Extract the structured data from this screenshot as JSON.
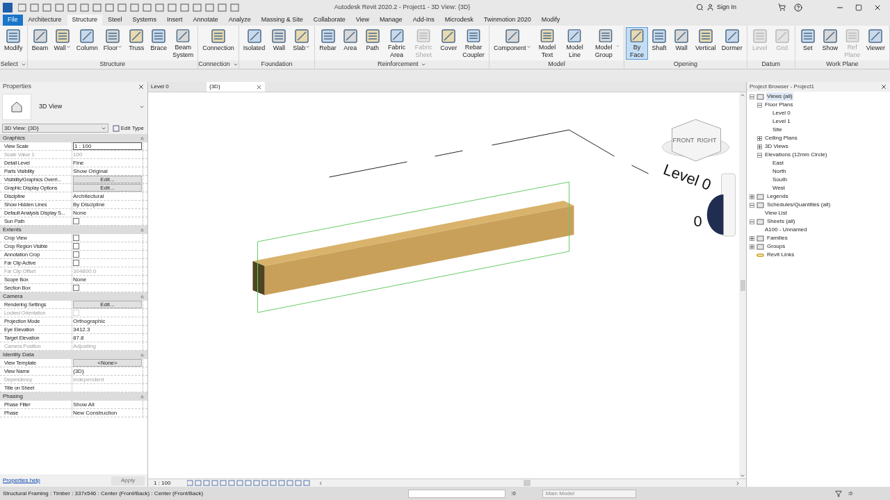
{
  "window": {
    "title": "Autodesk Revit 2020.2 - Project1 - 3D View: {3D}",
    "sign_in": "Sign In"
  },
  "menu_tabs": [
    {
      "label": "File",
      "kind": "file",
      "selected": false
    },
    {
      "label": "Architecture",
      "kind": "tab",
      "selected": false
    },
    {
      "label": "Structure",
      "kind": "tab",
      "selected": true
    },
    {
      "label": "Steel",
      "kind": "tab",
      "selected": false
    },
    {
      "label": "Systems",
      "kind": "tab",
      "selected": false
    },
    {
      "label": "Insert",
      "kind": "tab",
      "selected": false
    },
    {
      "label": "Annotate",
      "kind": "tab",
      "selected": false
    },
    {
      "label": "Analyze",
      "kind": "tab",
      "selected": false
    },
    {
      "label": "Massing & Site",
      "kind": "tab",
      "selected": false
    },
    {
      "label": "Collaborate",
      "kind": "tab",
      "selected": false
    },
    {
      "label": "View",
      "kind": "tab",
      "selected": false
    },
    {
      "label": "Manage",
      "kind": "tab",
      "selected": false
    },
    {
      "label": "Add-Ins",
      "kind": "tab",
      "selected": false
    },
    {
      "label": "Microdesk",
      "kind": "tab",
      "selected": false
    },
    {
      "label": "Twinmotion 2020",
      "kind": "tab",
      "selected": false
    },
    {
      "label": "Modify",
      "kind": "tab",
      "selected": false
    }
  ],
  "ribbon_panels": [
    {
      "title": "Select",
      "menu": true,
      "tools": [
        {
          "label": "Modify",
          "disabled": false,
          "selected": false,
          "dropdown": false
        }
      ]
    },
    {
      "title": "Structure",
      "menu": false,
      "tools": [
        {
          "label": "Beam",
          "disabled": false,
          "selected": false,
          "dropdown": false
        },
        {
          "label": "Wall",
          "disabled": false,
          "selected": false,
          "dropdown": true
        },
        {
          "label": "Column",
          "disabled": false,
          "selected": false,
          "dropdown": false
        },
        {
          "label": "Floor",
          "disabled": false,
          "selected": false,
          "dropdown": true
        },
        {
          "label": "Truss",
          "disabled": false,
          "selected": false,
          "dropdown": false
        },
        {
          "label": "Brace",
          "disabled": false,
          "selected": false,
          "dropdown": false
        },
        {
          "label": "Beam System",
          "disabled": false,
          "selected": false,
          "dropdown": false
        }
      ]
    },
    {
      "title": "Connection",
      "menu": true,
      "tools": [
        {
          "label": "Connection",
          "disabled": false,
          "selected": false,
          "dropdown": false
        }
      ]
    },
    {
      "title": "Foundation",
      "menu": false,
      "tools": [
        {
          "label": "Isolated",
          "disabled": false,
          "selected": false,
          "dropdown": false
        },
        {
          "label": "Wall",
          "disabled": false,
          "selected": false,
          "dropdown": false
        },
        {
          "label": "Slab",
          "disabled": false,
          "selected": false,
          "dropdown": true
        }
      ]
    },
    {
      "title": "Reinforcement",
      "menu": true,
      "tools": [
        {
          "label": "Rebar",
          "disabled": false,
          "selected": false,
          "dropdown": false
        },
        {
          "label": "Area",
          "disabled": false,
          "selected": false,
          "dropdown": false
        },
        {
          "label": "Path",
          "disabled": false,
          "selected": false,
          "dropdown": false
        },
        {
          "label": "Fabric Area",
          "disabled": false,
          "selected": false,
          "dropdown": false
        },
        {
          "label": "Fabric Sheet",
          "disabled": true,
          "selected": false,
          "dropdown": false
        },
        {
          "label": "Cover",
          "disabled": false,
          "selected": false,
          "dropdown": false
        },
        {
          "label": "Rebar Coupler",
          "disabled": false,
          "selected": false,
          "dropdown": false
        }
      ]
    },
    {
      "title": "Model",
      "menu": false,
      "tools": [
        {
          "label": "Component",
          "disabled": false,
          "selected": false,
          "dropdown": true
        },
        {
          "label": "Model Text",
          "disabled": false,
          "selected": false,
          "dropdown": false
        },
        {
          "label": "Model Line",
          "disabled": false,
          "selected": false,
          "dropdown": false
        },
        {
          "label": "Model Group",
          "disabled": false,
          "selected": false,
          "dropdown": true
        }
      ]
    },
    {
      "title": "Opening",
      "menu": false,
      "tools": [
        {
          "label": "By Face",
          "disabled": false,
          "selected": true,
          "dropdown": false
        },
        {
          "label": "Shaft",
          "disabled": false,
          "selected": false,
          "dropdown": false
        },
        {
          "label": "Wall",
          "disabled": false,
          "selected": false,
          "dropdown": false
        },
        {
          "label": "Vertical",
          "disabled": false,
          "selected": false,
          "dropdown": false
        },
        {
          "label": "Dormer",
          "disabled": false,
          "selected": false,
          "dropdown": false
        }
      ]
    },
    {
      "title": "Datum",
      "menu": false,
      "tools": [
        {
          "label": "Level",
          "disabled": true,
          "selected": false,
          "dropdown": false
        },
        {
          "label": "Grid",
          "disabled": true,
          "selected": false,
          "dropdown": false
        }
      ]
    },
    {
      "title": "Work Plane",
      "menu": false,
      "tools": [
        {
          "label": "Set",
          "disabled": false,
          "selected": false,
          "dropdown": false
        },
        {
          "label": "Show",
          "disabled": false,
          "selected": false,
          "dropdown": false
        },
        {
          "label": "Ref Plane",
          "disabled": true,
          "selected": false,
          "dropdown": false
        },
        {
          "label": "Viewer",
          "disabled": false,
          "selected": false,
          "dropdown": false
        }
      ]
    }
  ],
  "properties": {
    "title": "Properties",
    "type_name": "3D View",
    "instance": "3D View: {3D}",
    "edit_type": "Edit Type",
    "sections": [
      {
        "title": "Graphics",
        "expanded": true,
        "rows": [
          {
            "label": "View Scale",
            "value": "1 : 100",
            "kind": "input",
            "disabled": false
          },
          {
            "label": "Scale Value    1:",
            "value": "100",
            "kind": "text",
            "disabled": true
          },
          {
            "label": "Detail Level",
            "value": "Fine",
            "kind": "text",
            "disabled": false
          },
          {
            "label": "Parts Visibility",
            "value": "Show Original",
            "kind": "text",
            "disabled": false
          },
          {
            "label": "Visibility/Graphics Overri...",
            "value": "Edit...",
            "kind": "button",
            "disabled": false
          },
          {
            "label": "Graphic Display Options",
            "value": "Edit...",
            "kind": "button",
            "disabled": false
          },
          {
            "label": "Discipline",
            "value": "Architectural",
            "kind": "text",
            "disabled": false
          },
          {
            "label": "Show Hidden Lines",
            "value": "By Discipline",
            "kind": "text",
            "disabled": false
          },
          {
            "label": "Default Analysis Display S...",
            "value": "None",
            "kind": "text",
            "disabled": false
          },
          {
            "label": "Sun Path",
            "checked": false,
            "kind": "checkbox",
            "disabled": false
          }
        ]
      },
      {
        "title": "Extents",
        "expanded": true,
        "rows": [
          {
            "label": "Crop View",
            "checked": false,
            "kind": "checkbox",
            "disabled": false
          },
          {
            "label": "Crop Region Visible",
            "checked": false,
            "kind": "checkbox",
            "disabled": false
          },
          {
            "label": "Annotation Crop",
            "checked": false,
            "kind": "checkbox",
            "disabled": false
          },
          {
            "label": "Far Clip Active",
            "checked": false,
            "kind": "checkbox",
            "disabled": false
          },
          {
            "label": "Far Clip Offset",
            "value": "304800.0",
            "kind": "text",
            "disabled": true
          },
          {
            "label": "Scope Box",
            "value": "None",
            "kind": "text",
            "disabled": false
          },
          {
            "label": "Section Box",
            "checked": false,
            "kind": "checkbox",
            "disabled": false
          }
        ]
      },
      {
        "title": "Camera",
        "expanded": true,
        "rows": [
          {
            "label": "Rendering Settings",
            "value": "Edit...",
            "kind": "button",
            "disabled": false
          },
          {
            "label": "Locked Orientation",
            "checked": false,
            "kind": "checkbox",
            "disabled": true
          },
          {
            "label": "Projection Mode",
            "value": "Orthographic",
            "kind": "text",
            "disabled": false
          },
          {
            "label": "Eye Elevation",
            "value": "3412.3",
            "kind": "text",
            "disabled": false
          },
          {
            "label": "Target Elevation",
            "value": "87.8",
            "kind": "text",
            "disabled": false
          },
          {
            "label": "Camera Position",
            "value": "Adjusting",
            "kind": "text",
            "disabled": true
          }
        ]
      },
      {
        "title": "Identity Data",
        "expanded": true,
        "rows": [
          {
            "label": "View Template",
            "value": "<None>",
            "kind": "button",
            "disabled": false
          },
          {
            "label": "View Name",
            "value": "{3D}",
            "kind": "text",
            "disabled": false
          },
          {
            "label": "Dependency",
            "value": "Independent",
            "kind": "text",
            "disabled": true
          },
          {
            "label": "Title on Sheet",
            "value": "",
            "kind": "text",
            "disabled": false
          }
        ]
      },
      {
        "title": "Phasing",
        "expanded": true,
        "rows": [
          {
            "label": "Phase Filter",
            "value": "Show All",
            "kind": "text",
            "disabled": false
          },
          {
            "label": "Phase",
            "value": "New Construction",
            "kind": "text",
            "disabled": false
          }
        ]
      }
    ],
    "help_link": "Properties help",
    "apply": "Apply",
    "apply_disabled": true
  },
  "view_tabs": [
    {
      "label": "Level 0",
      "selected": false
    },
    {
      "label": "{3D}",
      "selected": true
    }
  ],
  "viewport": {
    "level_label": "Level 0",
    "level_tag": "0",
    "viewcube": [
      "FRONT",
      "RIGHT"
    ],
    "scale": "1 : 100"
  },
  "project_browser": {
    "title": "Project Browser - Project1",
    "tree": [
      {
        "label": "Views (all)",
        "expanded": true,
        "selected": true,
        "children": [
          {
            "label": "Floor Plans",
            "expanded": true,
            "children": [
              {
                "label": "Level 0"
              },
              {
                "label": "Level 1"
              },
              {
                "label": "Site"
              }
            ]
          },
          {
            "label": "Ceiling Plans",
            "expanded": false
          },
          {
            "label": "3D Views",
            "expanded": false
          },
          {
            "label": "Elevations (12mm Circle)",
            "expanded": true,
            "children": [
              {
                "label": "East"
              },
              {
                "label": "North"
              },
              {
                "label": "South"
              },
              {
                "label": "West"
              }
            ]
          }
        ]
      },
      {
        "label": "Legends",
        "expanded": false,
        "selected": false
      },
      {
        "label": "Schedules/Quantities (all)",
        "expanded": true,
        "selected": false,
        "children": [
          {
            "label": "View List"
          }
        ]
      },
      {
        "label": "Sheets (all)",
        "expanded": true,
        "selected": false,
        "children": [
          {
            "label": "A100 - Unnamed"
          }
        ]
      },
      {
        "label": "Families",
        "expanded": false,
        "selected": false
      },
      {
        "label": "Groups",
        "expanded": false,
        "selected": false
      },
      {
        "label": "Revit Links",
        "selected": false
      }
    ]
  },
  "status_bar": {
    "message": "Structural Framing : Timber : 337x546 : Center (Front/Back) : Center (Front/Back)",
    "worksets_count": ":0",
    "model": "Main Model",
    "filter_count": ":0"
  }
}
